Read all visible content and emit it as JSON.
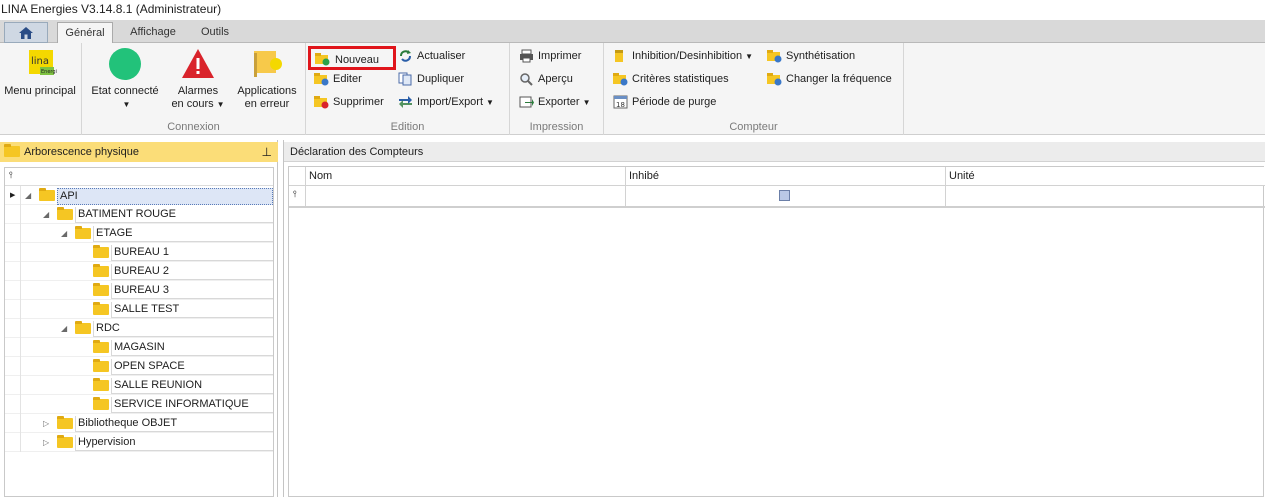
{
  "window": {
    "title": "LINA Energies  V3.14.8.1  (Administrateur)"
  },
  "tabs": [
    {
      "label": "Général",
      "active": true
    },
    {
      "label": "Affichage",
      "active": false
    },
    {
      "label": "Outils",
      "active": false
    }
  ],
  "ribbon": {
    "menu_principal": "Menu principal",
    "connexion": {
      "label": "Connexion",
      "etat_connecte": "Etat connecté",
      "alarmes_l1": "Alarmes",
      "alarmes_l2": "en cours",
      "applications_l1": "Applications",
      "applications_l2": "en erreur"
    },
    "edition": {
      "label": "Edition",
      "nouveau": "Nouveau",
      "editer": "Editer",
      "supprimer": "Supprimer",
      "actualiser": "Actualiser",
      "dupliquer": "Dupliquer",
      "import_export": "Import/Export"
    },
    "impression": {
      "label": "Impression",
      "imprimer": "Imprimer",
      "apercu": "Aperçu",
      "exporter": "Exporter"
    },
    "compteur": {
      "label": "Compteur",
      "inhibition": "Inhibition/Desinhibition",
      "criteres": "Critères statistiques",
      "periode": "Période de purge",
      "synthetisation": "Synthétisation",
      "changer_frequence": "Changer la fréquence"
    },
    "colors": {
      "highlight": "#e0151b",
      "status_connected": "#22c27a",
      "alarm": "#d9232b"
    }
  },
  "left_panel": {
    "title": "Arborescence physique",
    "tree": [
      {
        "label": "API",
        "level": 0,
        "expander": "▼",
        "selected": true
      },
      {
        "label": "BATIMENT ROUGE",
        "level": 1,
        "expander": "▼"
      },
      {
        "label": "ETAGE",
        "level": 2,
        "expander": "▼"
      },
      {
        "label": "BUREAU 1",
        "level": 3,
        "expander": ""
      },
      {
        "label": "BUREAU 2",
        "level": 3,
        "expander": ""
      },
      {
        "label": "BUREAU 3",
        "level": 3,
        "expander": ""
      },
      {
        "label": "SALLE TEST",
        "level": 3,
        "expander": ""
      },
      {
        "label": "RDC",
        "level": 2,
        "expander": "▼"
      },
      {
        "label": "MAGASIN",
        "level": 3,
        "expander": ""
      },
      {
        "label": "OPEN SPACE",
        "level": 3,
        "expander": ""
      },
      {
        "label": "SALLE REUNION",
        "level": 3,
        "expander": ""
      },
      {
        "label": "SERVICE INFORMATIQUE",
        "level": 3,
        "expander": ""
      },
      {
        "label": "Bibliotheque OBJET",
        "level": 1,
        "expander": "▶"
      },
      {
        "label": "Hypervision",
        "level": 1,
        "expander": "▶"
      }
    ]
  },
  "right_panel": {
    "title": "Déclaration des Compteurs",
    "columns": [
      "Nom",
      "Inhibé",
      "Unité"
    ]
  }
}
